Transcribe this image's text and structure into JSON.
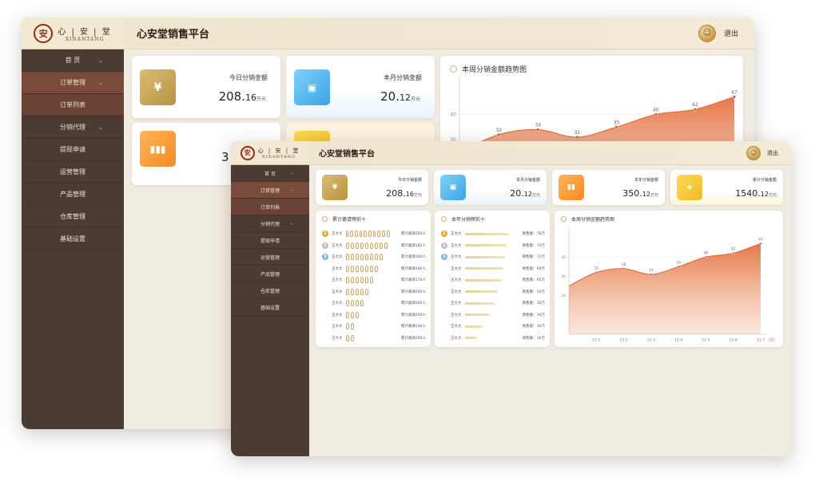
{
  "app": {
    "title": "心安堂销售平台",
    "brand_cn": [
      "心",
      "安",
      "堂"
    ],
    "brand_en": "XINANTANG",
    "logout": "退出"
  },
  "menu": [
    {
      "label": "首 页",
      "has_chevron": true
    },
    {
      "label": "订单管理",
      "has_chevron": true
    },
    {
      "label": "订单列表",
      "has_chevron": false
    },
    {
      "label": "分销代理",
      "has_chevron": true
    },
    {
      "label": "提现申请",
      "has_chevron": false
    },
    {
      "label": "运营管理",
      "has_chevron": false
    },
    {
      "label": "产品管理",
      "has_chevron": false
    },
    {
      "label": "仓库管理",
      "has_chevron": false
    },
    {
      "label": "基础设置",
      "has_chevron": false
    }
  ],
  "stats": [
    {
      "label": "今日分销金额",
      "value": "208.",
      "decimal": "16",
      "unit": "万元",
      "color": "#c9a54f",
      "icon": "yuan-icon"
    },
    {
      "label": "本月分销金额",
      "value": "20.",
      "decimal": "12",
      "unit": "万元",
      "color": "#4fb6ea",
      "icon": "wallet-icon"
    },
    {
      "label": "本年分销金额",
      "value": "350.",
      "decimal": "12",
      "unit": "万元",
      "color": "#f79b3a",
      "icon": "bar-chart-icon"
    },
    {
      "label": "累计分销金额",
      "value": "1540.",
      "decimal": "12",
      "unit": "万元",
      "color": "#f3c632",
      "icon": "stack-icon"
    }
  ],
  "back_partial": {
    "stat3_value_lead": "3"
  },
  "invite_panel": {
    "title": "累计邀请榜前十",
    "rows": [
      {
        "rank": "1",
        "name": "王大大",
        "figures": 10,
        "text": "累计邀请200人"
      },
      {
        "rank": "2",
        "name": "王大大",
        "figures": 9,
        "text": "累计邀请185人"
      },
      {
        "rank": "3",
        "name": "王大大",
        "figures": 8,
        "text": "累计邀请180人"
      },
      {
        "rank": "",
        "name": "王大大",
        "figures": 7,
        "text": "累计邀请180人"
      },
      {
        "rank": "",
        "name": "王大大",
        "figures": 6,
        "text": "累计邀请170人"
      },
      {
        "rank": "",
        "name": "王大大",
        "figures": 5,
        "text": "累计邀请200人"
      },
      {
        "rank": "",
        "name": "王大大",
        "figures": 4,
        "text": "累计邀请200人"
      },
      {
        "rank": "",
        "name": "王大大",
        "figures": 3,
        "text": "累计邀请200人"
      },
      {
        "rank": "",
        "name": "王大大",
        "figures": 2,
        "text": "累计邀请200人"
      },
      {
        "rank": "",
        "name": "王大大",
        "figures": 2,
        "text": "累计邀请200人"
      }
    ]
  },
  "sales_panel": {
    "title": "本年分销榜前十",
    "rows": [
      {
        "rank": "1",
        "name": "王大大",
        "share": 1.0,
        "text": "销售额：78万"
      },
      {
        "rank": "2",
        "name": "王大大",
        "share": 0.95,
        "text": "销售额：74万"
      },
      {
        "rank": "3",
        "name": "王大大",
        "share": 0.91,
        "text": "销售额：71万"
      },
      {
        "rank": "",
        "name": "王大大",
        "share": 0.88,
        "text": "销售额：69万"
      },
      {
        "rank": "",
        "name": "王大大",
        "share": 0.84,
        "text": "销售额：65万"
      },
      {
        "rank": "",
        "name": "王大大",
        "share": 0.75,
        "text": "销售额：59万"
      },
      {
        "rank": "",
        "name": "王大大",
        "share": 0.68,
        "text": "销售额：30万"
      },
      {
        "rank": "",
        "name": "王大大",
        "share": 0.58,
        "text": "销售额：30万"
      },
      {
        "rank": "",
        "name": "王大大",
        "share": 0.4,
        "text": "销售额：30万"
      },
      {
        "rank": "",
        "name": "王大大",
        "share": 0.28,
        "text": "销售额：30万"
      }
    ]
  },
  "trend_panel": {
    "title": "本周分销金额趋势图"
  },
  "chart_data": {
    "type": "area",
    "x": [
      "12-1",
      "12-2",
      "12-3",
      "12-4",
      "12-5",
      "12-6",
      "12-7"
    ],
    "y_full": [
      32,
      34,
      31,
      35,
      40,
      42,
      47
    ],
    "y_tail": 25,
    "x_unit": "(日)",
    "yticks": [
      20,
      30,
      40
    ],
    "ylim": [
      0,
      55
    ],
    "fill_top": "#e4713f",
    "fill_bottom": "#f7d7c4",
    "line_color": "#d9643a"
  }
}
